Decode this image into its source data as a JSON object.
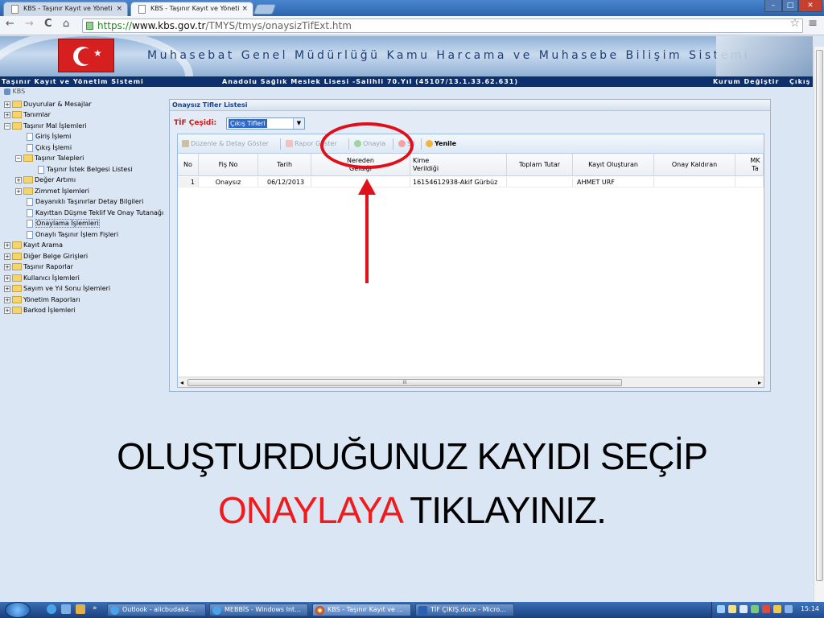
{
  "browser": {
    "tabs": [
      {
        "label": "KBS - Taşınır Kayıt ve Yöneti",
        "close": "×"
      },
      {
        "label": "KBS - Taşınır Kayıt ve Yöneti",
        "close": "×"
      }
    ],
    "window_controls": {
      "minimize": "–",
      "maximize": "□",
      "close": "✕"
    },
    "nav": {
      "back": "←",
      "forward": "→",
      "reload": "C",
      "home": "⌂"
    },
    "url": {
      "scheme": "https://",
      "host": "www.kbs.gov.tr",
      "path": "/TMYS/tmys/onaysizTifExt.htm"
    },
    "star": "☆",
    "menu": "≡"
  },
  "banner": {
    "title": "Muhasebat Genel Müdürlüğü Kamu Harcama ve Muhasebe Bilişim Sistemi"
  },
  "infobar": {
    "system": "Taşınır Kayıt ve Yönetim Sistemi",
    "unit": "Anadolu Sağlık Meslek Lisesi -Salihli 70.Yıl (45107/13.1.33.62.631)",
    "change_unit": "Kurum Değiştir",
    "logout": "Çıkış"
  },
  "sidebar": {
    "root": "KBS",
    "items": [
      "Duyurular & Mesajlar",
      "Tanımlar",
      "Taşınır Mal İşlemleri",
      "Giriş İşlemi",
      "Çıkış İşlemi",
      "Taşınır Talepleri",
      "Taşınır İstek Belgesi Listesi",
      "Değer Artımı",
      "Zimmet İşlemleri",
      "Dayanıklı Taşınırlar Detay Bilgileri",
      "Kayıttan Düşme Teklif Ve Onay Tutanağı",
      "Onaylama İşlemleri",
      "Onaylı Taşınır İşlem Fişleri",
      "Kayıt Arama",
      "Diğer Belge Girişleri",
      "Taşınır Raporlar",
      "Kullanıcı İşlemleri",
      "Sayım ve Yıl Sonu İşlemleri",
      "Yönetim Raporları",
      "Barkod İşlemleri"
    ]
  },
  "panel": {
    "title": "Onaysız Tifler Listesi",
    "tif_label": "TİF Çeşidi:",
    "tif_value": "Çıkış Tifleri",
    "toolbar": {
      "edit": "Düzenle & Detay Göster",
      "report": "Rapor Göster",
      "approve": "Onayla",
      "delete": "Sil",
      "refresh": "Yenile"
    },
    "columns": [
      "No",
      "Fiş No",
      "Tarih",
      "Nereden Geldiği",
      "Kime Verildiği",
      "Toplam Tutar",
      "Kayıt Oluşturan",
      "Onay Kaldıran",
      "MK Ta"
    ],
    "rows": [
      {
        "no": "1",
        "fis_no": "Onaysız",
        "tarih": "06/12/2013",
        "nereden": "",
        "kime": "16154612938-Akif Gürbüz",
        "toplam": "",
        "olusturan": "AHMET URF",
        "kaldiran": "",
        "mk": ""
      }
    ],
    "scroll_label": "III"
  },
  "caption": {
    "line1": "OLUŞTURDUĞUNUZ KAYIDI SEÇİP",
    "line2_red": "ONAYLAYA",
    "line2_rest": " TIKLAYINIZ."
  },
  "taskbar": {
    "apps": [
      "Outlook - alicbudak4...",
      "MEBBİS - Windows Int...",
      "KBS - Taşınır Kayıt ve ...",
      "TİF ÇIKIŞ.docx - Micro..."
    ],
    "clock": "15:14"
  },
  "colors": {
    "accent_red": "#e0101a",
    "header_navy": "#0d2f6b",
    "caption_red": "#ee1c1c"
  }
}
